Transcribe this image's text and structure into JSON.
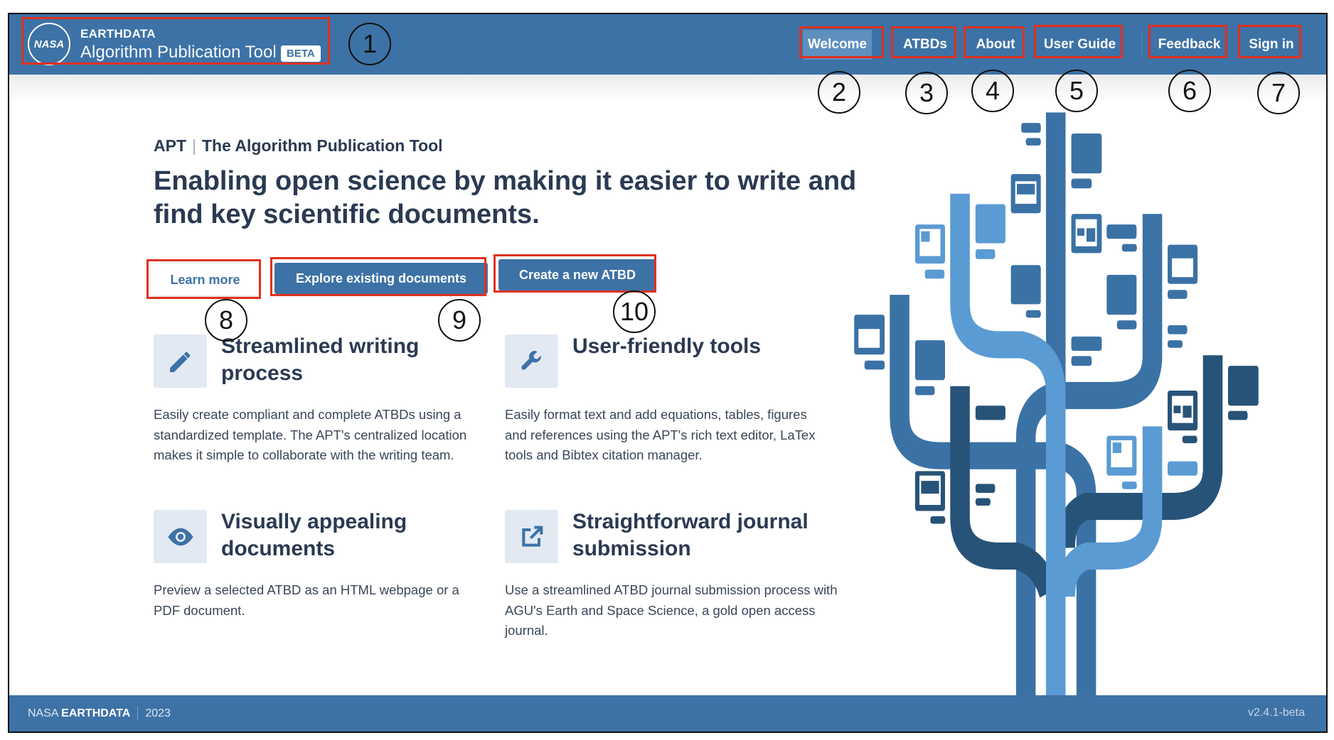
{
  "header": {
    "logo_text": "NASA",
    "brand_top": "EARTHDATA",
    "app_title": "Algorithm Publication Tool",
    "badge": "BETA",
    "nav": [
      {
        "label": "Welcome",
        "active": true
      },
      {
        "label": "ATBDs"
      },
      {
        "label": "About"
      },
      {
        "label": "User Guide"
      },
      {
        "label": "Feedback"
      },
      {
        "label": "Sign in"
      }
    ]
  },
  "main": {
    "breadcrumb_short": "APT",
    "breadcrumb_long": "The Algorithm Publication Tool",
    "headline": "Enabling open science by making it easier to write and find key scientific documents.",
    "buttons": {
      "learn_more": "Learn more",
      "explore": "Explore existing documents",
      "create": "Create a new ATBD"
    },
    "features": [
      {
        "icon": "pencil-icon",
        "title": "Streamlined writing process",
        "description": "Easily create compliant and complete ATBDs using a standardized template. The APT's centralized location makes it simple to collaborate with the writing team."
      },
      {
        "icon": "wrench-icon",
        "title": "User-friendly tools",
        "description": "Easily format text and add equations, tables, figures and references using the APT's rich text editor, LaTex tools and Bibtex citation manager."
      },
      {
        "icon": "eye-icon",
        "title": "Visually appealing documents",
        "description": "Preview a selected ATBD as an HTML webpage or a PDF document."
      },
      {
        "icon": "external-link-icon",
        "title": "Straightforward journal submission",
        "description": "Use a streamlined ATBD journal submission process with AGU's Earth and Space Science, a gold open access journal."
      }
    ]
  },
  "footer": {
    "org": "NASA",
    "brand": "EARTHDATA",
    "year": "2023",
    "version": "v2.4.1-beta"
  },
  "annotations": [
    "1",
    "2",
    "3",
    "4",
    "5",
    "6",
    "7",
    "8",
    "9",
    "10"
  ],
  "colors": {
    "primary": "#3d72a6",
    "light": "#5b9bd3",
    "dark": "#285379",
    "highlight": "#e0301e"
  }
}
